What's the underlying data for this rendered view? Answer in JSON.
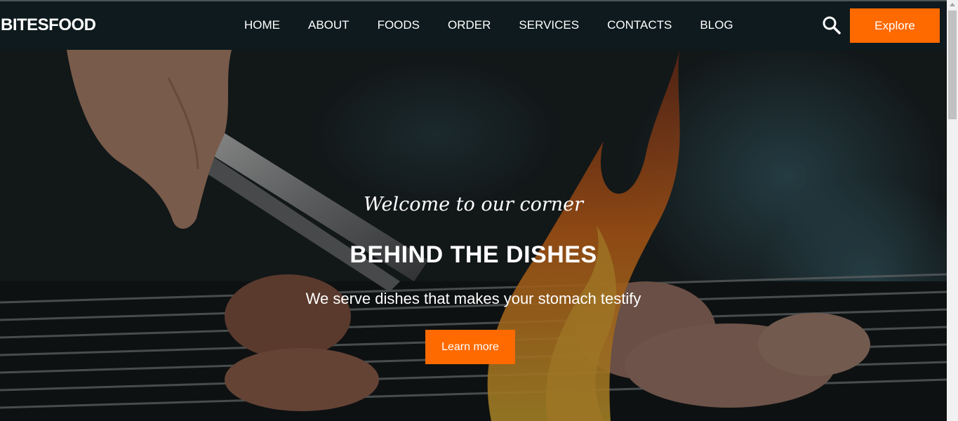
{
  "brand": "BITESFOOD",
  "nav": {
    "items": [
      {
        "label": "HOME"
      },
      {
        "label": "ABOUT"
      },
      {
        "label": "FOODS"
      },
      {
        "label": "ORDER"
      },
      {
        "label": "SERVICES"
      },
      {
        "label": "CONTACTS"
      },
      {
        "label": "BLOG"
      }
    ],
    "search_icon": "search-icon",
    "explore_label": "Explore"
  },
  "hero": {
    "welcome": "Welcome to our corner",
    "title": "BEHIND THE DISHES",
    "subtitle": "We serve dishes that makes your stomach testify",
    "button_label": "Learn more"
  },
  "colors": {
    "accent": "#ff6a00",
    "navbar": "#0e1a1d",
    "text": "#ffffff"
  }
}
